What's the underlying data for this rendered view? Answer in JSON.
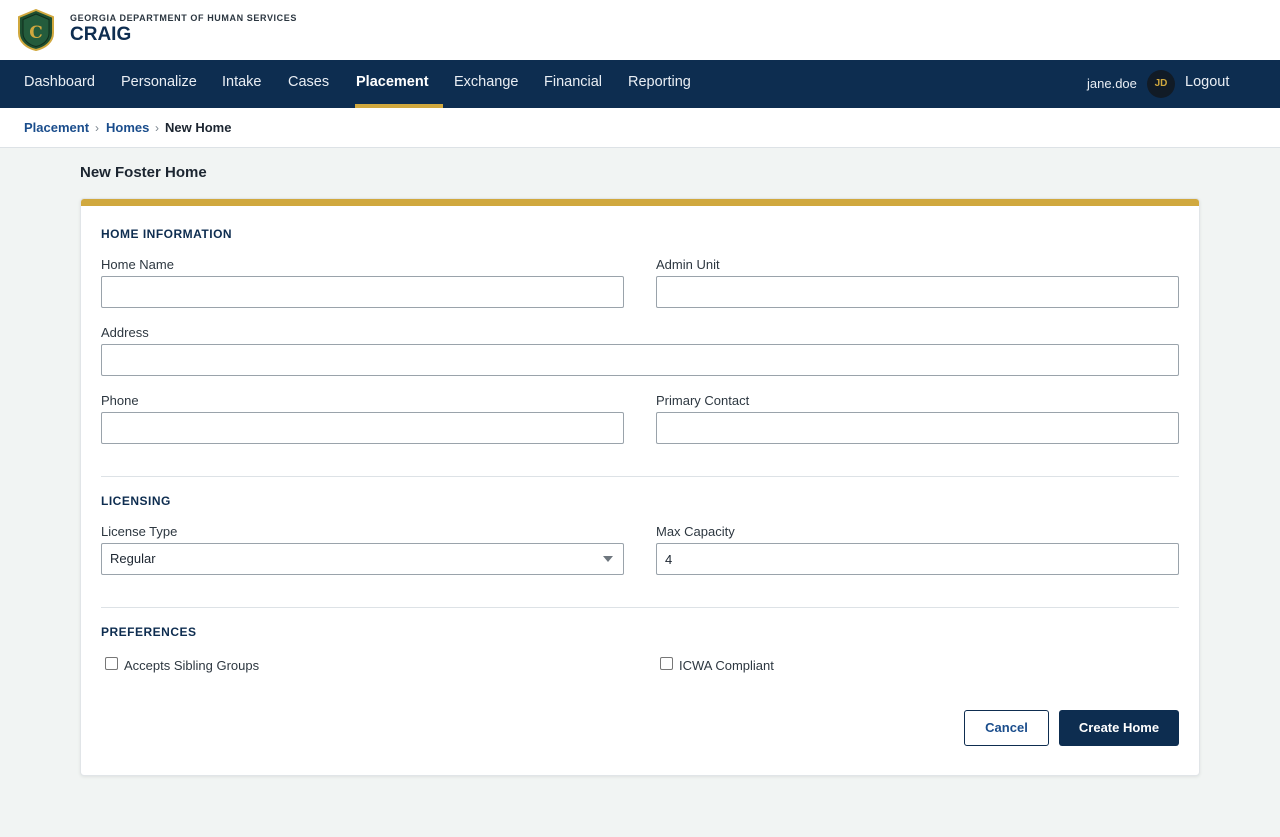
{
  "header": {
    "agency": "GEORGIA DEPARTMENT OF HUMAN SERVICES",
    "app_name": "CRAIG",
    "logo_letter": "C",
    "logo_icon": "shield-logo-icon"
  },
  "nav": {
    "items": [
      {
        "label": "Dashboard"
      },
      {
        "label": "Personalize"
      },
      {
        "label": "Intake"
      },
      {
        "label": "Cases"
      },
      {
        "label": "Placement",
        "active": true
      },
      {
        "label": "Exchange"
      },
      {
        "label": "Financial"
      },
      {
        "label": "Reporting"
      }
    ],
    "username": "jane.doe",
    "avatar_initials": "JD",
    "logout_label": "Logout"
  },
  "breadcrumb": {
    "items": [
      "Placement",
      "Homes",
      "New Home"
    ],
    "separator": "›"
  },
  "page": {
    "title": "New Foster Home"
  },
  "form": {
    "home_information": {
      "title": "HOME INFORMATION",
      "home_name": {
        "label": "Home Name",
        "value": ""
      },
      "admin_unit": {
        "label": "Admin Unit",
        "value": ""
      },
      "address": {
        "label": "Address",
        "value": ""
      },
      "phone": {
        "label": "Phone",
        "value": ""
      },
      "primary_contact": {
        "label": "Primary Contact",
        "value": ""
      }
    },
    "licensing": {
      "title": "LICENSING",
      "license_type": {
        "label": "License Type",
        "value": "Regular"
      },
      "max_capacity": {
        "label": "Max Capacity",
        "value": "4"
      }
    },
    "preferences": {
      "title": "PREFERENCES",
      "accepts_sibling_groups": {
        "label": "Accepts Sibling Groups",
        "checked": false
      },
      "icwa_compliant": {
        "label": "ICWA Compliant",
        "checked": false
      }
    },
    "actions": {
      "cancel_label": "Cancel",
      "create_label": "Create Home"
    }
  },
  "colors": {
    "navy": "#0d2d50",
    "gold": "#d0a83e",
    "link": "#1a4d8c",
    "background": "#f1f4f3"
  }
}
